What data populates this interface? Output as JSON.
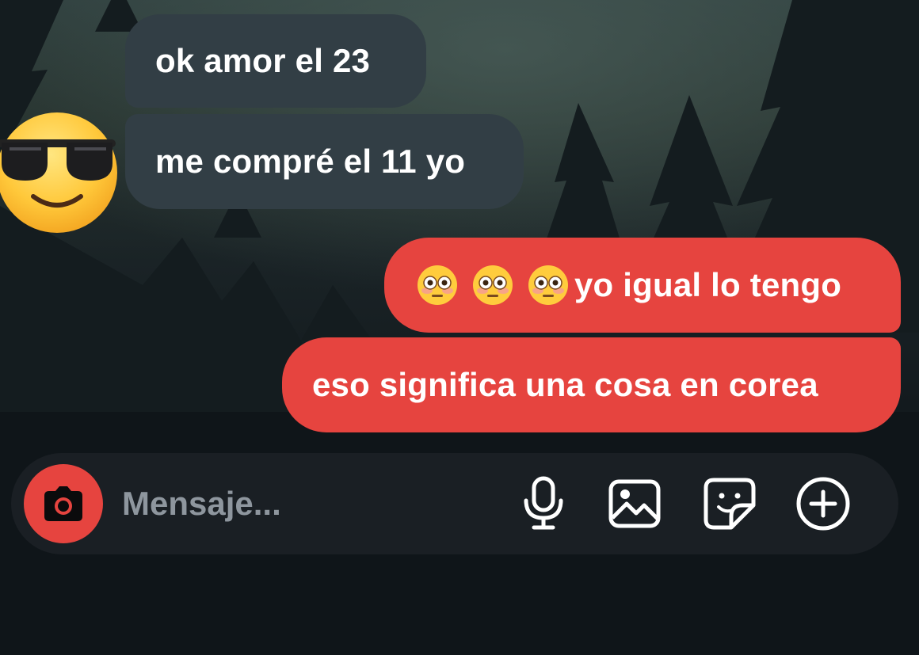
{
  "chat": {
    "messages": [
      {
        "direction": "incoming",
        "text": "ok amor el 23"
      },
      {
        "direction": "incoming",
        "text": "me compré el 11 yo"
      },
      {
        "direction": "outgoing",
        "emoji_prefix": [
          "flushed-face",
          "flushed-face",
          "flushed-face"
        ],
        "text": "yo igual lo tengo"
      },
      {
        "direction": "outgoing",
        "text": "eso significa una cosa en corea"
      }
    ],
    "sender_avatar_icon": "smiling-face-with-sunglasses"
  },
  "composer": {
    "placeholder": "Mensaje...",
    "value": "",
    "icons": {
      "camera": "camera-icon",
      "mic": "microphone-icon",
      "gallery": "image-icon",
      "sticker": "sticker-icon",
      "plus": "plus-circle-icon"
    }
  },
  "colors": {
    "incoming_bubble": "#323e45",
    "outgoing_bubble": "#e6443f",
    "composer_bg": "#1a1f24",
    "text": "#ffffff",
    "placeholder": "#8e969e"
  }
}
